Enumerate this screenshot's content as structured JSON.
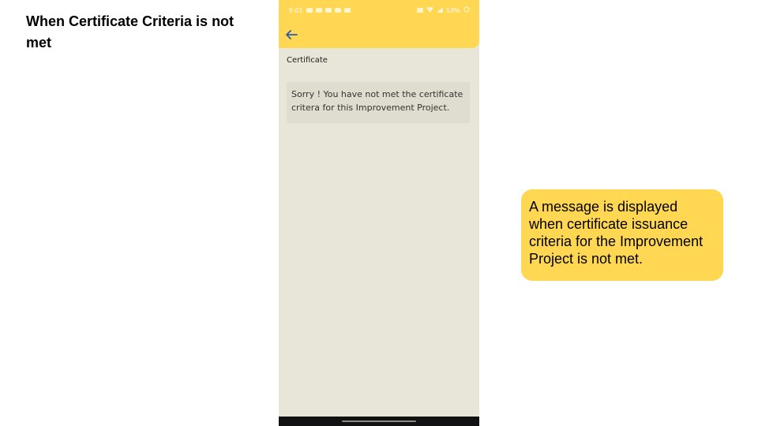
{
  "slide": {
    "title": "When Certificate Criteria is not met",
    "callout": "A message is displayed when certificate issuance criteria for the Improvement Project is not met."
  },
  "phone": {
    "status_bar": {
      "time": "9:01",
      "battery": "53%"
    },
    "section_label": "Certificate",
    "message": "Sorry ! You have not met the certificate critera for this Improvement Project."
  },
  "colors": {
    "accent": "#ffd752",
    "app_background": "#e8e6d8",
    "card_background": "#dfddcf",
    "back_arrow": "#2e5fa6",
    "nav_bar": "#121212"
  },
  "icons": {
    "back": "arrow-left-icon",
    "battery": "battery-icon",
    "wifi": "wifi-icon",
    "signal": "signal-icon"
  }
}
